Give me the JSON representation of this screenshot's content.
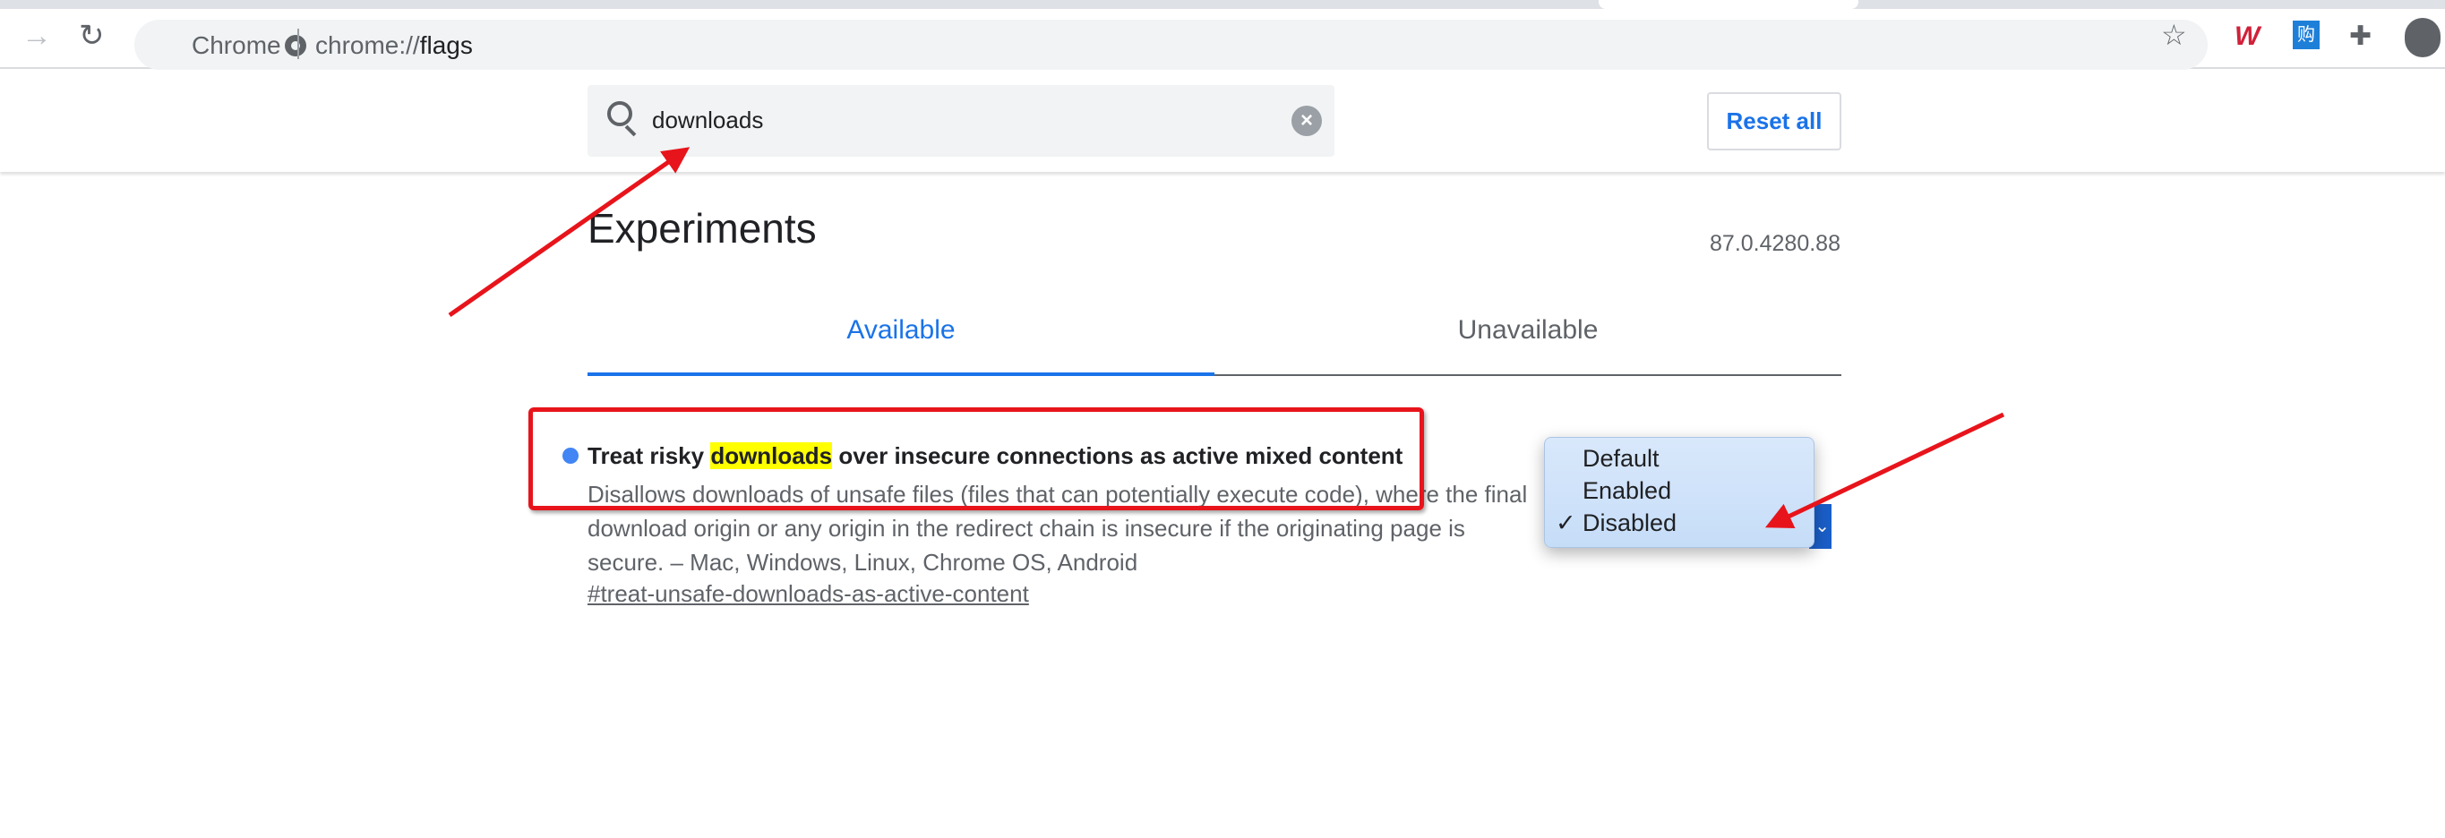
{
  "browser": {
    "site_label": "Chrome",
    "url_prefix": "chrome://",
    "url_path": "flags",
    "icons": [
      "back-arrow-icon",
      "reload-icon",
      "chrome-icon",
      "star-icon",
      "extension-w-icon",
      "extension-gou-icon",
      "puzzle-icon",
      "profile-icon"
    ]
  },
  "header": {
    "search_value": "downloads",
    "reset_label": "Reset all"
  },
  "main": {
    "title": "Experiments",
    "version": "87.0.4280.88",
    "tabs": [
      {
        "label": "Available",
        "active": true
      },
      {
        "label": "Unavailable",
        "active": false
      }
    ]
  },
  "experiment": {
    "title_before": "Treat risky ",
    "title_highlight": "downloads",
    "title_after": " over insecure connections as active mixed content",
    "description": "Disallows downloads of unsafe files (files that can potentially execute code), where the final download origin or any origin in the redirect chain is insecure if the originating page is secure. – Mac, Windows, Linux, Chrome OS, Android",
    "link": "#treat-unsafe-downloads-as-active-content"
  },
  "dropdown": {
    "options": [
      "Default",
      "Enabled",
      "Disabled"
    ],
    "selected": "Disabled",
    "check": "✓"
  },
  "colors": {
    "accent": "#1a73e8",
    "annotation": "#e8141b",
    "highlight": "#ffff00"
  }
}
